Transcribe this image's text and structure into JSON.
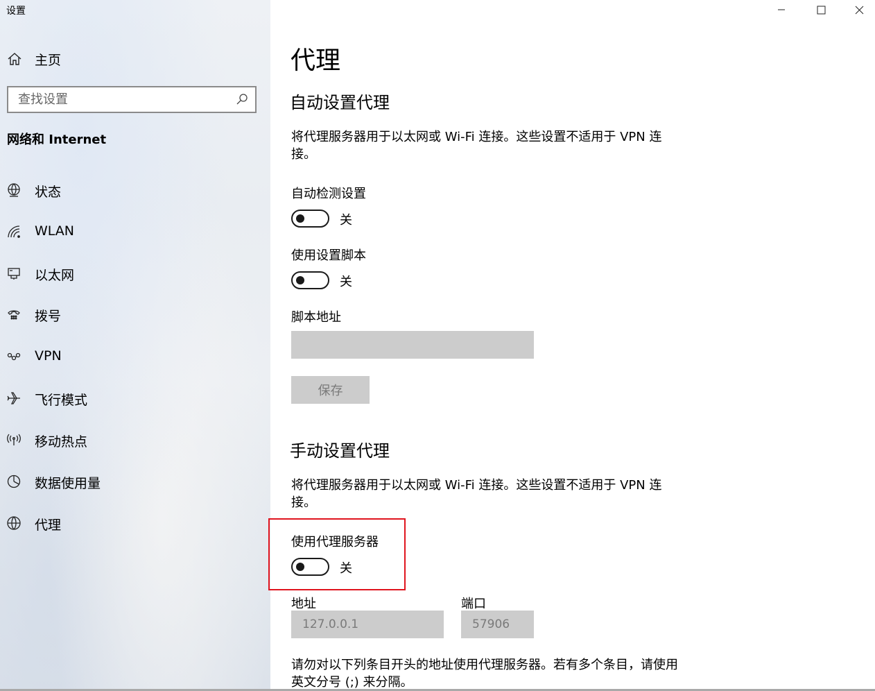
{
  "window": {
    "title": "设置"
  },
  "sidebar": {
    "home_label": "主页",
    "search_placeholder": "查找设置",
    "section_title": "网络和 Internet",
    "items": [
      {
        "label": "状态",
        "icon": "status-globe-icon"
      },
      {
        "label": "WLAN",
        "icon": "wifi-icon"
      },
      {
        "label": "以太网",
        "icon": "ethernet-icon"
      },
      {
        "label": "拨号",
        "icon": "dialup-icon"
      },
      {
        "label": "VPN",
        "icon": "vpn-icon"
      },
      {
        "label": "飞行模式",
        "icon": "airplane-icon"
      },
      {
        "label": "移动热点",
        "icon": "hotspot-icon"
      },
      {
        "label": "数据使用量",
        "icon": "data-usage-icon"
      },
      {
        "label": "代理",
        "icon": "globe-icon"
      }
    ]
  },
  "main": {
    "page_title": "代理",
    "auto": {
      "heading": "自动设置代理",
      "description": "将代理服务器用于以太网或 Wi-Fi 连接。这些设置不适用于 VPN 连接。",
      "detect_label": "自动检测设置",
      "detect_state": "关",
      "script_label": "使用设置脚本",
      "script_state": "关",
      "address_label": "脚本地址",
      "address_value": "",
      "save_label": "保存"
    },
    "manual": {
      "heading": "手动设置代理",
      "description": "将代理服务器用于以太网或 Wi-Fi 连接。这些设置不适用于 VPN 连接。",
      "use_proxy_label": "使用代理服务器",
      "use_proxy_state": "关",
      "address_label": "地址",
      "address_value": "127.0.0.1",
      "port_label": "端口",
      "port_value": "57906",
      "exceptions_text": "请勿对以下列条目开头的地址使用代理服务器。若有多个条目，请使用英文分号 (;) 来分隔。"
    }
  },
  "colors": {
    "highlight": "#e0141e",
    "disabled_bg": "#cccccc",
    "toggle_stroke": "#1a1a1a"
  }
}
